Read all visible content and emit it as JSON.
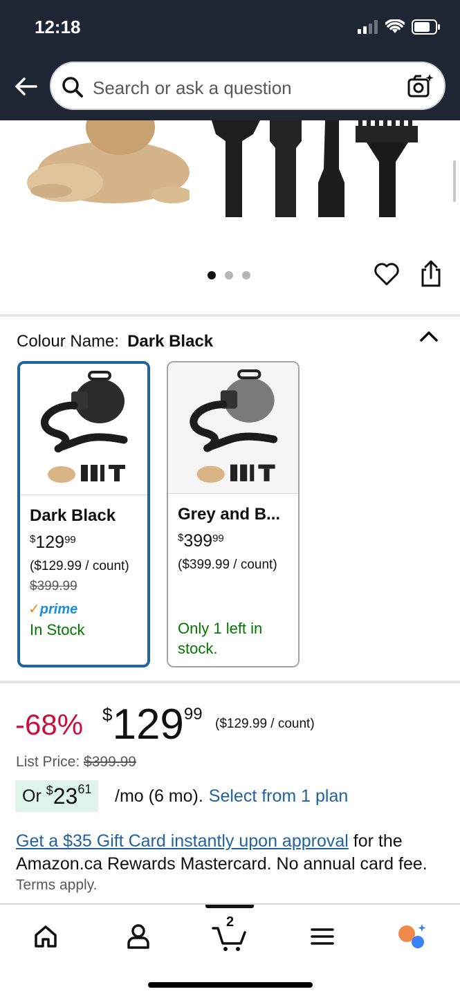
{
  "status_bar": {
    "time": "12:18"
  },
  "search": {
    "placeholder": "Search or ask a question"
  },
  "gallery": {
    "image_count": 3,
    "active_index": 0
  },
  "colour": {
    "label": "Colour Name:",
    "value": "Dark Black",
    "options": [
      {
        "name": "Dark Black",
        "price_symbol": "$",
        "price_whole": "129",
        "price_cents": "99",
        "unit_price": "($129.99 / count)",
        "list_price": "$399.99",
        "prime_label": "prime",
        "availability": "In Stock",
        "selected": true
      },
      {
        "name": "Grey and B...",
        "price_symbol": "$",
        "price_whole": "399",
        "price_cents": "99",
        "unit_price": "($399.99 / count)",
        "availability": "Only 1 left in stock.",
        "selected": false
      }
    ]
  },
  "price": {
    "discount": "-68%",
    "symbol": "$",
    "whole": "129",
    "cents": "99",
    "unit_price": "($129.99 / count)",
    "list_label": "List Price:",
    "list_value": "$399.99"
  },
  "monthly": {
    "prefix": "Or",
    "symbol": "$",
    "whole": "23",
    "cents": "61",
    "terms": "/mo (6 mo).",
    "link": "Select from 1 plan"
  },
  "gift_card": {
    "link": "Get a $35 Gift Card instantly upon approval",
    "text": " for the Amazon.ca Rewards Mastercard. No annual card fee.",
    "terms": "Terms apply."
  },
  "bottom_nav": {
    "items": [
      "home-icon",
      "account-icon",
      "cart-icon",
      "menu-icon",
      "rufus-icon"
    ],
    "cart_count": "2"
  },
  "colors": {
    "header_bg": "#1f2633",
    "deal_red": "#cc0c39",
    "link_blue": "#2162a1",
    "stock_green": "#007600",
    "selected_border": "#2162a1",
    "chip_green": "#dff5ea"
  }
}
